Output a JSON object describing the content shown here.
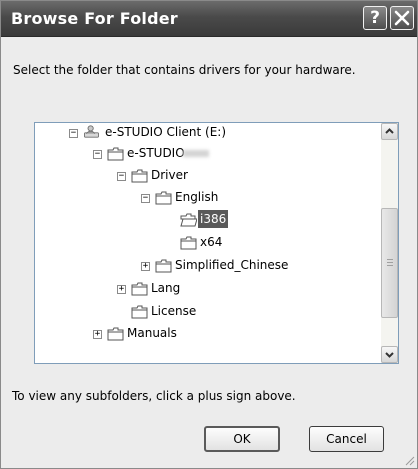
{
  "window": {
    "title": "Browse For Folder",
    "help_label": "?",
    "prompt": "Select the folder that contains drivers for your hardware.",
    "hint": "To view any subfolders, click a plus sign above."
  },
  "tree": {
    "items": [
      {
        "label": "e-STUDIO Client (E:)",
        "expander": "−",
        "icon": "drive-user-icon"
      },
      {
        "label": "e-STUDIO",
        "expander": "−",
        "icon": "folder-icon"
      },
      {
        "label": "Driver",
        "expander": "−",
        "icon": "folder-icon"
      },
      {
        "label": "English",
        "expander": "−",
        "icon": "folder-icon"
      },
      {
        "label": "i386",
        "expander": "",
        "icon": "open-folder-icon",
        "selected": true
      },
      {
        "label": "x64",
        "expander": "",
        "icon": "folder-icon"
      },
      {
        "label": "Simplified_Chinese",
        "expander": "+",
        "icon": "folder-icon"
      },
      {
        "label": "Lang",
        "expander": "+",
        "icon": "folder-icon"
      },
      {
        "label": "License",
        "expander": "",
        "icon": "folder-icon"
      },
      {
        "label": "Manuals",
        "expander": "+",
        "icon": "folder-icon"
      }
    ]
  },
  "buttons": {
    "ok": "OK",
    "cancel": "Cancel"
  },
  "colors": {
    "titlebar": "#4a4a4a",
    "selection": "#5a5a5a",
    "dialog_bg": "#ececec"
  }
}
